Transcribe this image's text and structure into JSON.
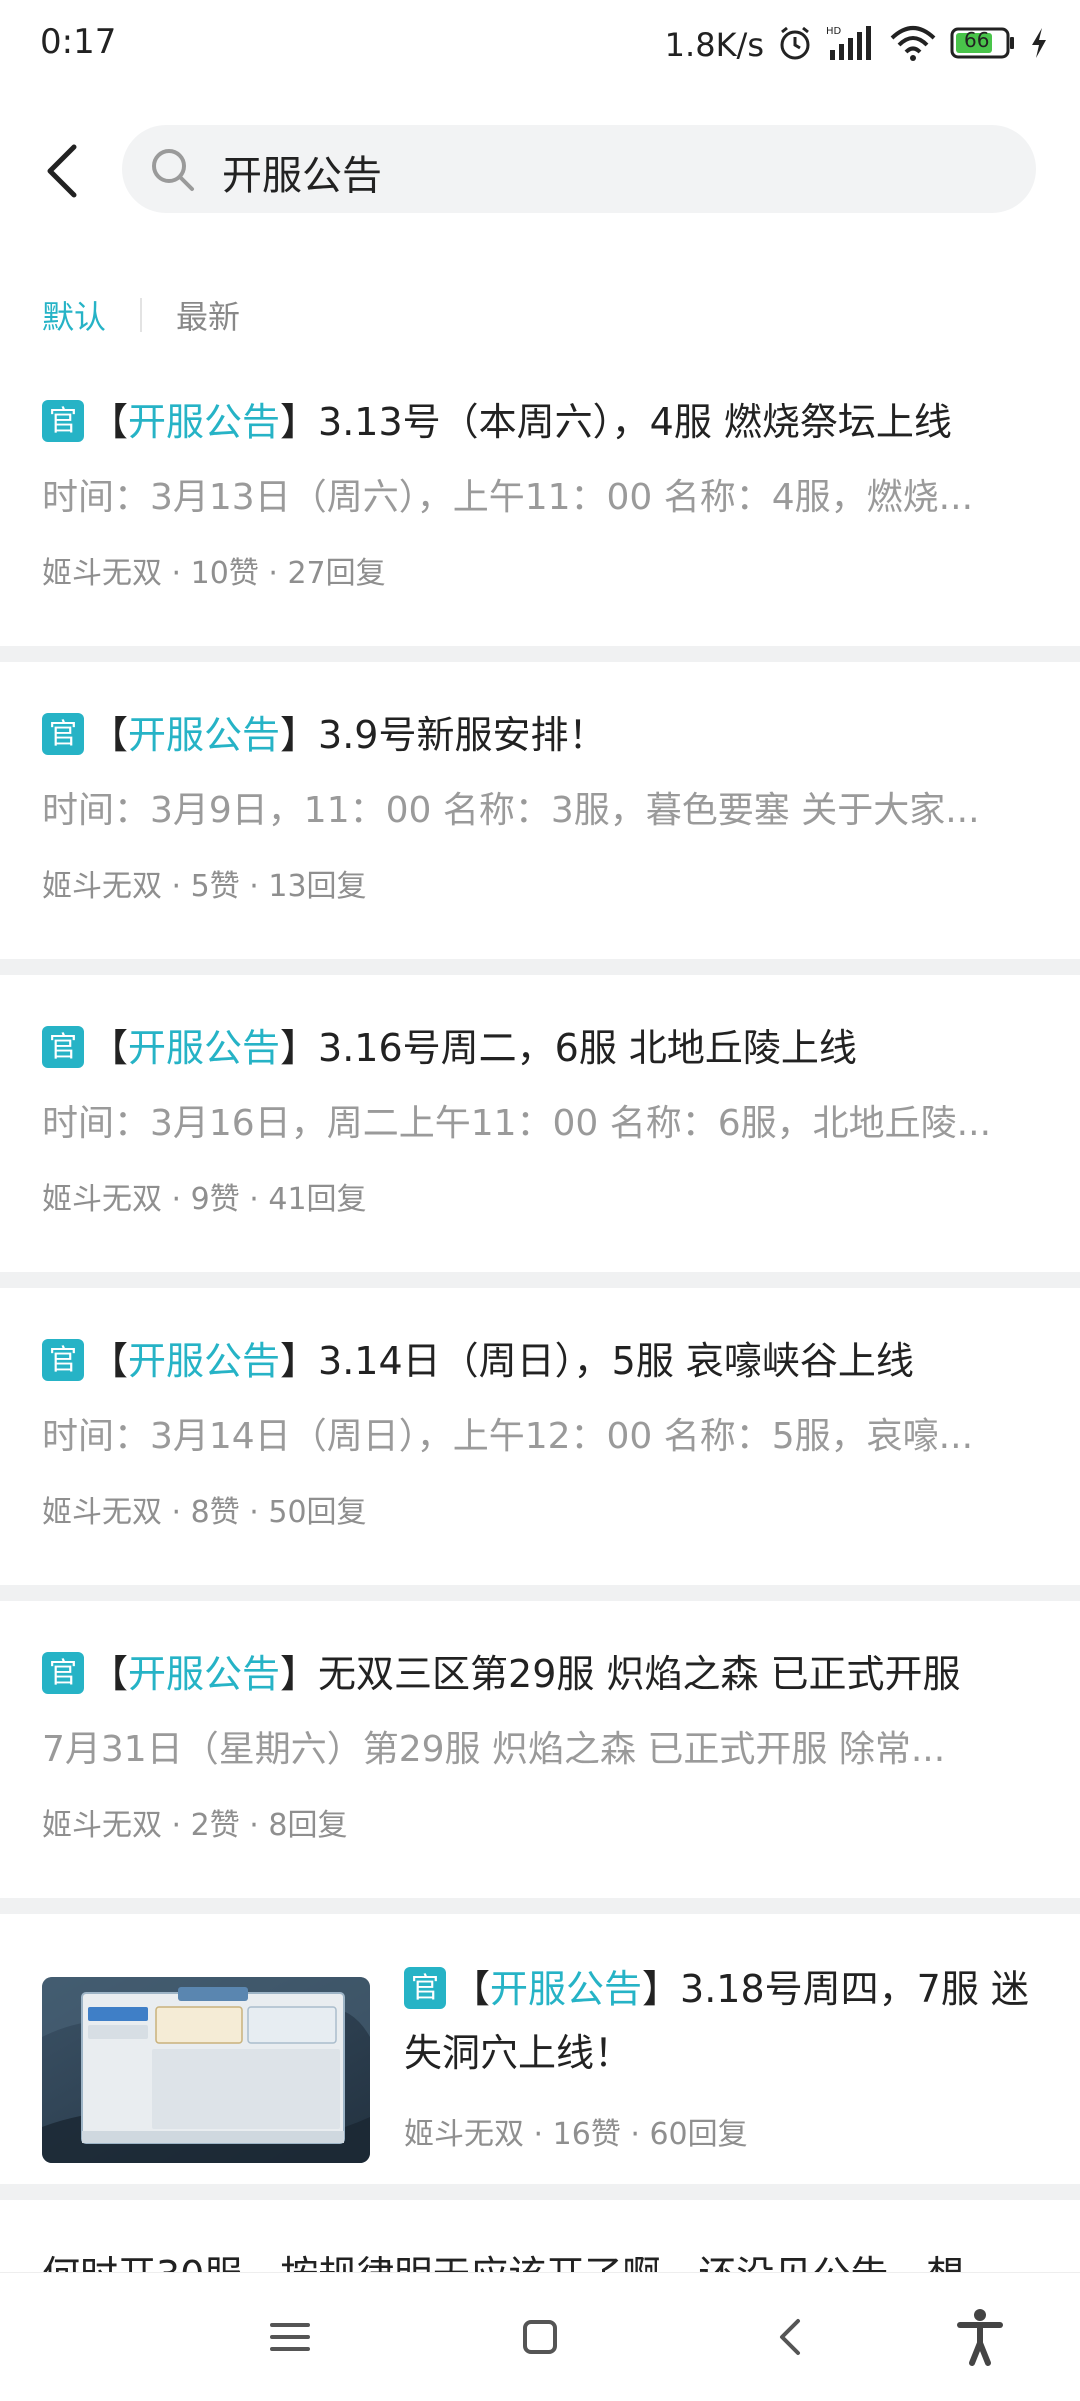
{
  "status_bar": {
    "time": "0:17",
    "net_speed": "1.8K/s",
    "battery": "66"
  },
  "search": {
    "query": "开服公告"
  },
  "sort": {
    "default_label": "默认",
    "latest_label": "最新"
  },
  "colors": {
    "accent": "#26b3c6"
  },
  "posts": [
    {
      "badge": "官",
      "open_bracket": "【",
      "tag": "开服公告",
      "close_bracket": "】",
      "title": "3.13号（本周六），4服 燃烧祭坛上线",
      "excerpt": "时间：3月13日（周六），上午11：00 名称：4服，燃烧...",
      "author": "姬斗无双",
      "likes": "10赞",
      "replies": "27回复",
      "dot": "·"
    },
    {
      "badge": "官",
      "open_bracket": "【",
      "tag": "开服公告",
      "close_bracket": "】",
      "title": "3.9号新服安排！",
      "excerpt": "时间：3月9日，11：00 名称：3服，暮色要塞 关于大家...",
      "author": "姬斗无双",
      "likes": "5赞",
      "replies": "13回复",
      "dot": "·"
    },
    {
      "badge": "官",
      "open_bracket": "【",
      "tag": "开服公告",
      "close_bracket": "】",
      "title": "3.16号周二，6服 北地丘陵上线",
      "excerpt": "时间：3月16日，周二上午11：00 名称：6服，北地丘陵...",
      "author": "姬斗无双",
      "likes": "9赞",
      "replies": "41回复",
      "dot": "·"
    },
    {
      "badge": "官",
      "open_bracket": "【",
      "tag": "开服公告",
      "close_bracket": "】",
      "title": "3.14日（周日），5服 哀嚎峡谷上线",
      "excerpt": "时间：3月14日（周日），上午12：00 名称：5服，哀嚎...",
      "author": "姬斗无双",
      "likes": "8赞",
      "replies": "50回复",
      "dot": "·"
    },
    {
      "badge": "官",
      "open_bracket": "【",
      "tag": "开服公告",
      "close_bracket": "】",
      "title": "无双三区第29服 炽焰之森  已正式开服",
      "excerpt": "7月31日（星期六）第29服 炽焰之森 已正式开服 除常...",
      "author": "姬斗无双",
      "likes": "2赞",
      "replies": "8回复",
      "dot": "·"
    }
  ],
  "image_post": {
    "badge": "官",
    "open_bracket": "【",
    "tag": "开服公告",
    "close_bracket": "】",
    "title": "3.18号周四，7服 迷失洞穴上线！",
    "author": "姬斗无双",
    "likes": "16赞",
    "replies": "60回复",
    "dot": "·"
  },
  "partial_post": {
    "title": "何时开30服，按规律明天应该开了啊，还没见公告，想"
  }
}
